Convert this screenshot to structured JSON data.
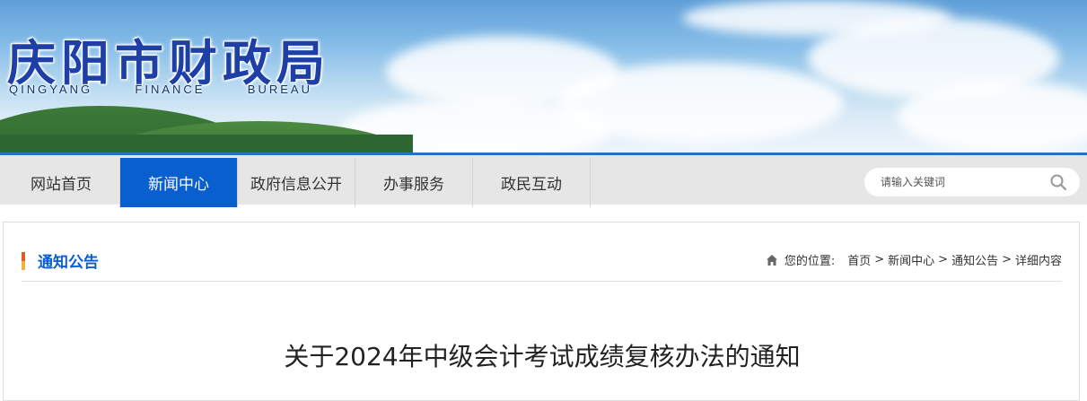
{
  "header": {
    "title": "庆阳市财政局",
    "subtitle_words": [
      "QINGYANG",
      "FINANCE",
      "BUREAU"
    ]
  },
  "nav": {
    "items": [
      {
        "label": "网站首页",
        "active": false
      },
      {
        "label": "新闻中心",
        "active": true
      },
      {
        "label": "政府信息公开",
        "active": false
      },
      {
        "label": "办事服务",
        "active": false
      },
      {
        "label": "政民互动",
        "active": false
      }
    ],
    "search_placeholder": "请输入关键词",
    "search_icon": "search-icon"
  },
  "section": {
    "title": "通知公告"
  },
  "breadcrumb": {
    "label": "您的位置:",
    "items": [
      "首页",
      "新闻中心",
      "通知公告",
      "详细内容"
    ],
    "separator": ">",
    "icon": "home-icon"
  },
  "article": {
    "title": "关于2024年中级会计考试成绩复核办法的通知"
  },
  "colors": {
    "accent": "#0a5fcf",
    "nav_bg": "#e6e6e6"
  }
}
